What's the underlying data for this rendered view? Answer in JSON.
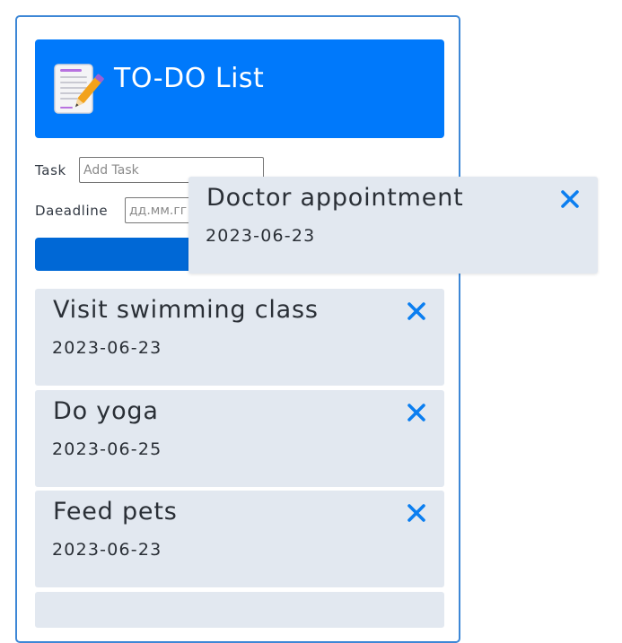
{
  "header": {
    "title": "TO-DO List",
    "logo_icon": "notepad-pencil-icon"
  },
  "form": {
    "task_label": "Task",
    "task_placeholder": "Add Task",
    "deadline_label": "Daeadline",
    "deadline_placeholder": "дд.мм.гг",
    "add_button_label": ""
  },
  "tasks": [
    {
      "title": "Visit swimming class",
      "date": "2023-06-23"
    },
    {
      "title": "Do yoga",
      "date": "2023-06-25"
    },
    {
      "title": "Feed pets",
      "date": "2023-06-23"
    }
  ],
  "dragged_task": {
    "title": "Doctor appointment",
    "date": "2023-06-23"
  },
  "colors": {
    "accent": "#0079fb",
    "button": "#0068d6",
    "card_bg": "#e2e8f0",
    "delete_icon": "#0b7ef0",
    "frame_border": "#3d87d6"
  }
}
